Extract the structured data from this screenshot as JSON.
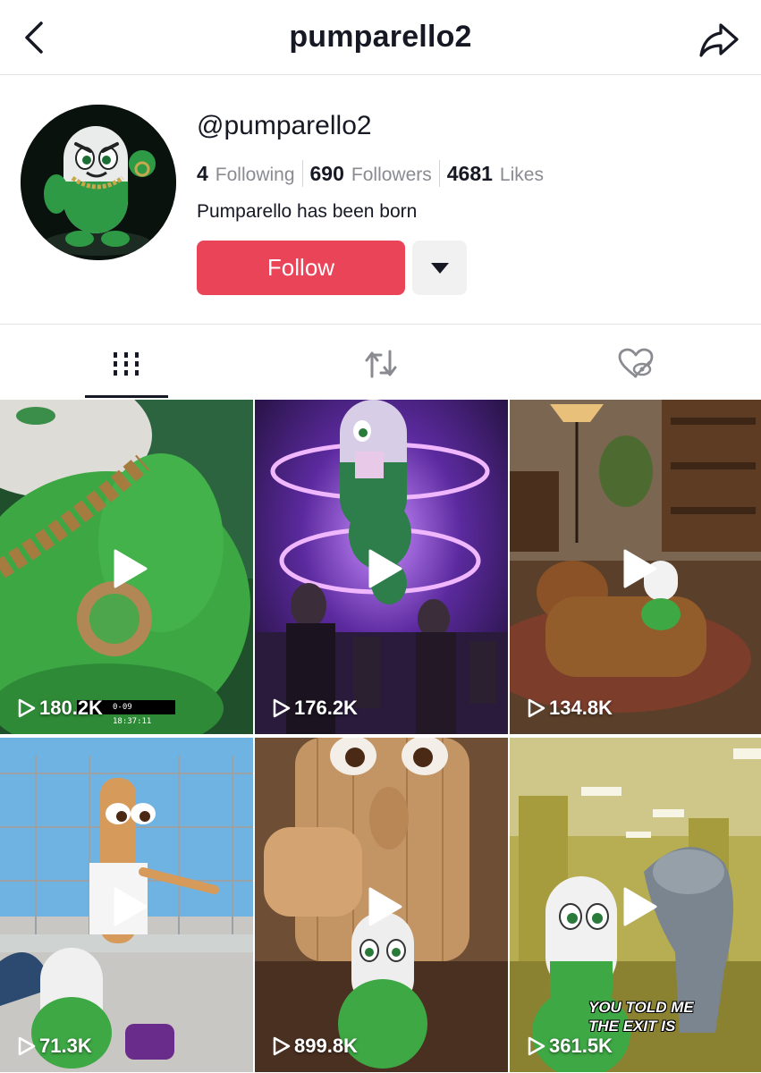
{
  "header": {
    "title": "pumparello2",
    "back_icon": "chevron-left-icon",
    "share_icon": "share-arrow-icon"
  },
  "profile": {
    "handle": "@pumparello2",
    "stats": [
      {
        "value": "4",
        "label": "Following"
      },
      {
        "value": "690",
        "label": "Followers"
      },
      {
        "value": "4681",
        "label": "Likes"
      }
    ],
    "bio": "Pumparello has been born",
    "follow_label": "Follow",
    "dropdown_icon": "caret-down-icon"
  },
  "tabs": [
    {
      "icon": "videos-grid-icon",
      "active": true
    },
    {
      "icon": "repost-icon",
      "active": false
    },
    {
      "icon": "liked-hidden-icon",
      "active": false
    }
  ],
  "colors": {
    "follow_button": "#ea4459",
    "text_primary": "#161823",
    "text_secondary": "#8a8b91"
  },
  "videos": [
    {
      "views": "180.2K",
      "stamp": "0-09 18:37:11"
    },
    {
      "views": "176.2K"
    },
    {
      "views": "134.8K"
    },
    {
      "views": "71.3K"
    },
    {
      "views": "899.8K"
    },
    {
      "views": "361.5K",
      "caption_line1": "YOU TOLD ME",
      "caption_line2": "THE EXIT IS"
    }
  ]
}
